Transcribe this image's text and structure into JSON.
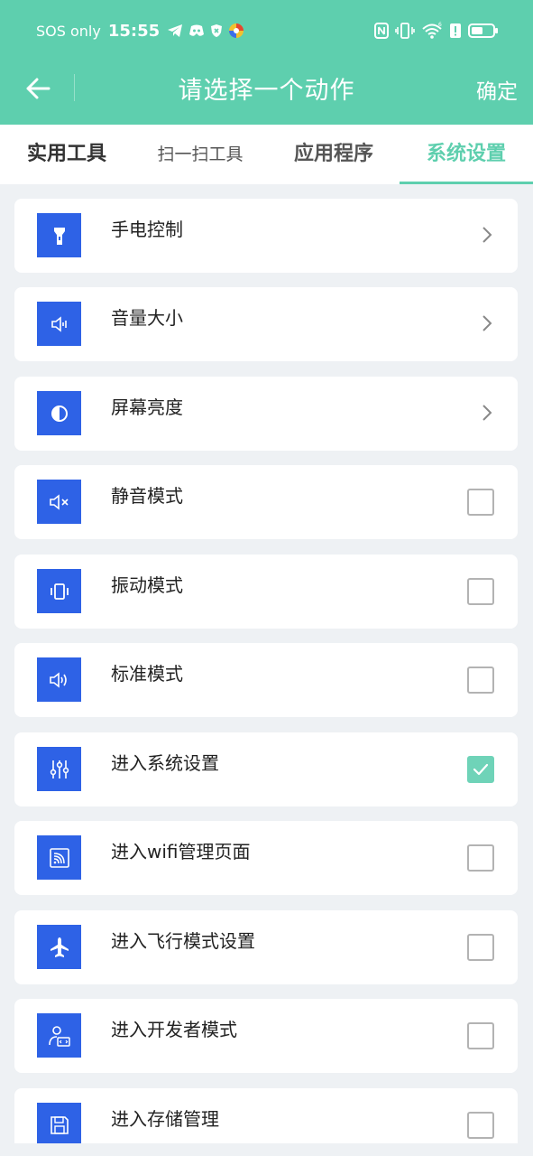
{
  "status_bar": {
    "carrier": "SOS only",
    "time": "15:55",
    "icons_left": [
      "telegram-icon",
      "discord-icon",
      "shield-icon",
      "color-app-icon"
    ],
    "icons_right": [
      "nfc-icon",
      "vibrate-icon",
      "wifi-icon",
      "alert-icon",
      "battery-icon"
    ]
  },
  "header": {
    "title": "请选择一个动作",
    "confirm_label": "确定"
  },
  "tabs": [
    {
      "label": "实用工具",
      "active": false
    },
    {
      "label": "扫一扫工具",
      "active": false
    },
    {
      "label": "应用程序",
      "active": false
    },
    {
      "label": "系统设置",
      "active": true
    }
  ],
  "colors": {
    "accent": "#5ecfae",
    "icon_bg": "#2e62e6",
    "checked": "#6fd3b8"
  },
  "items": [
    {
      "label": "手电控制",
      "icon": "flashlight-icon",
      "control": "chevron"
    },
    {
      "label": "音量大小",
      "icon": "volume-icon",
      "control": "chevron"
    },
    {
      "label": "屏幕亮度",
      "icon": "brightness-icon",
      "control": "chevron"
    },
    {
      "label": "静音模式",
      "icon": "mute-icon",
      "control": "checkbox",
      "checked": false
    },
    {
      "label": "振动模式",
      "icon": "vibrate-mode-icon",
      "control": "checkbox",
      "checked": false
    },
    {
      "label": "标准模式",
      "icon": "speaker-icon",
      "control": "checkbox",
      "checked": false
    },
    {
      "label": "进入系统设置",
      "icon": "sliders-icon",
      "control": "checkbox",
      "checked": true
    },
    {
      "label": "进入wifi管理页面",
      "icon": "wifi-screen-icon",
      "control": "checkbox",
      "checked": false
    },
    {
      "label": "进入飞行模式设置",
      "icon": "airplane-icon",
      "control": "checkbox",
      "checked": false
    },
    {
      "label": "进入开发者模式",
      "icon": "developer-icon",
      "control": "checkbox",
      "checked": false
    },
    {
      "label": "进入存储管理",
      "icon": "storage-icon",
      "control": "checkbox",
      "checked": false
    }
  ]
}
